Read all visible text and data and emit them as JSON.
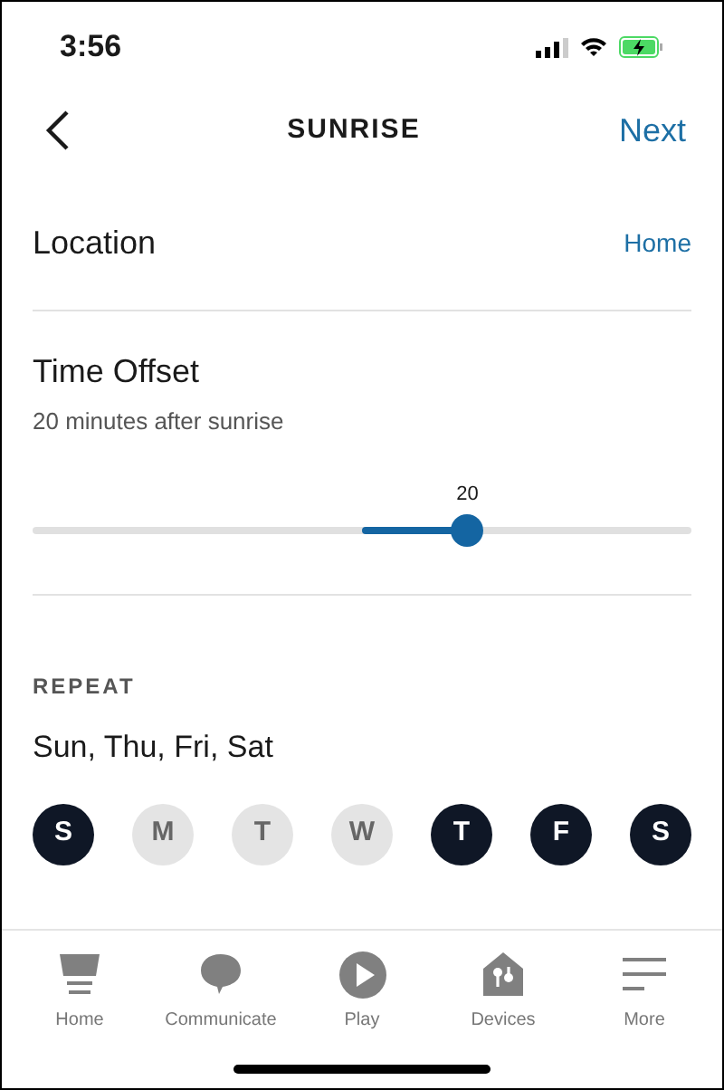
{
  "status_bar": {
    "time": "3:56"
  },
  "nav": {
    "title": "SUNRISE",
    "action": "Next"
  },
  "location": {
    "label": "Location",
    "value": "Home"
  },
  "time_offset": {
    "label": "Time Offset",
    "description": "20 minutes after sunrise",
    "slider": {
      "reading": "20",
      "level": 0.66
    }
  },
  "repeat": {
    "heading": "REPEAT",
    "summary": "Sun, Thu, Fri, Sat",
    "days": [
      {
        "label": "S",
        "selected": true
      },
      {
        "label": "M",
        "selected": false
      },
      {
        "label": "T",
        "selected": false
      },
      {
        "label": "W",
        "selected": false
      },
      {
        "label": "T",
        "selected": true
      },
      {
        "label": "F",
        "selected": true
      },
      {
        "label": "S",
        "selected": true
      }
    ]
  },
  "tab_bar": [
    {
      "label": "Home",
      "kind": "home"
    },
    {
      "label": "Communicate",
      "kind": "communicate"
    },
    {
      "label": "Play",
      "kind": "play"
    },
    {
      "label": "Devices",
      "kind": "devices"
    },
    {
      "label": "More",
      "kind": "more"
    }
  ]
}
